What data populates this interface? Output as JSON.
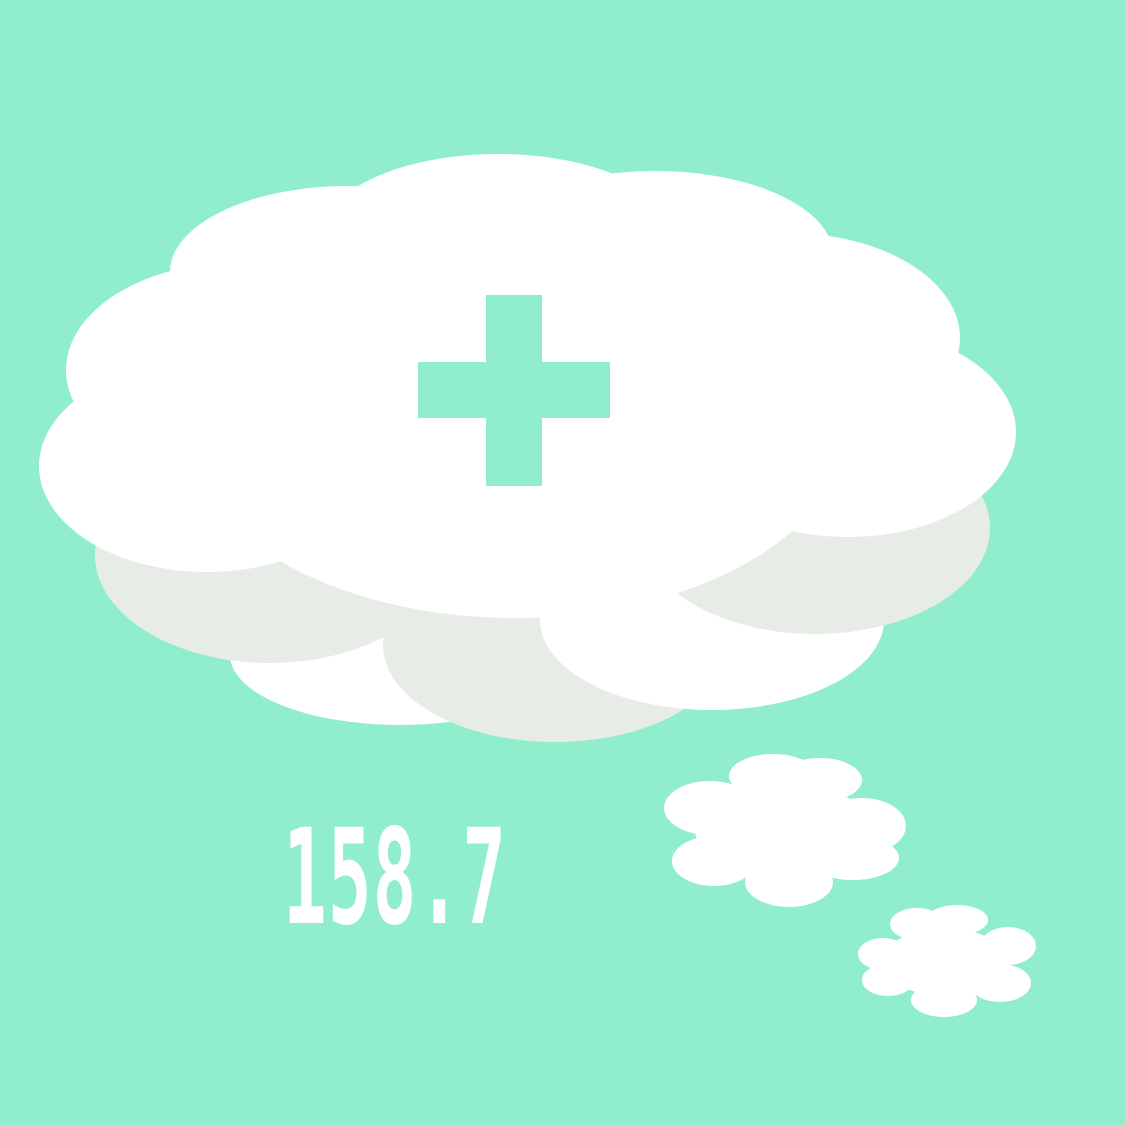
{
  "display": {
    "value": "158.7",
    "icon": "plus-icon"
  },
  "colors": {
    "background": "#91eecd",
    "cloud": "#ffffff",
    "cloud_shadow": "#e7ede6",
    "plus": "#91eecd",
    "text": "#ffffff"
  }
}
